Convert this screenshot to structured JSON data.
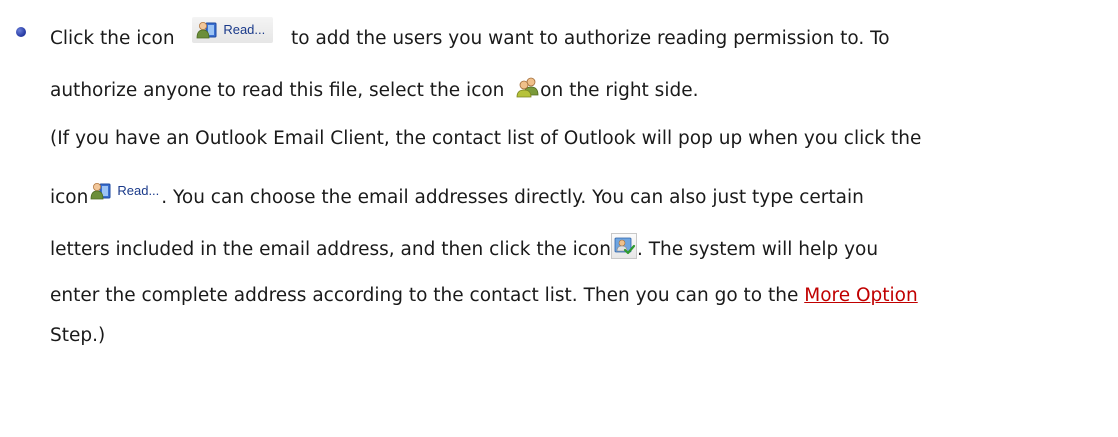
{
  "icons": {
    "read_button_label": "Read...",
    "read_button_icon": "contacts-book-icon",
    "anyone_icon": "people-icon",
    "check_names_icon": "check-names-icon"
  },
  "paragraph": {
    "l1a": "Click the icon",
    "l1b": "to add the users you want to authorize reading permission to. To",
    "l2a": "authorize anyone to read this file, select the icon",
    "l2b": "on the right side.",
    "l3": "(If you have an Outlook Email Client, the contact list of Outlook will pop up when you click the",
    "l4a": "icon",
    "l4b": ". You can choose the email addresses directly. You can also just type certain",
    "l5a": "letters included in the email address, and then click the icon",
    "l5b": ". The system will help you",
    "l6a": "enter the complete address according to the contact list. Then you can go to the",
    "link": "More Option",
    "l7": "Step.)"
  },
  "colors": {
    "link": "#c00000",
    "bullet": "#2b3fa8"
  }
}
